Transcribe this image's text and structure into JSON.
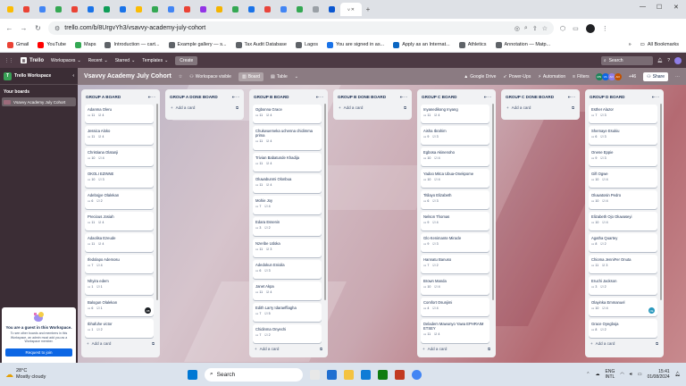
{
  "browser": {
    "active_tab_label": "V",
    "address": "trello.com/b/8UrgvYh3/vsavvy-academy-july-cohort",
    "bookmarks": [
      "Gmail",
      "YouTube",
      "Maps",
      "Introduction — cart...",
      "Example gallery — s...",
      "Tax Audit Database",
      "Lagos",
      "You are signed in as...",
      "Apply as an Internat...",
      "Athletics",
      "Annotation — Matp..."
    ],
    "all_bookmarks": "All Bookmarks"
  },
  "trello": {
    "logo": "Trello",
    "menu": [
      "Workspaces",
      "Recent",
      "Starred",
      "Templates"
    ],
    "create": "Create",
    "search": "Search"
  },
  "sidebar": {
    "workspace": "Trello Workspace",
    "your_boards": "Your boards",
    "board_item": "Vsavvy Academy July Cohort",
    "guest_title": "You are a guest in this Workspace.",
    "guest_body": "To see other boards and members in this Workspace, an admin must add you as a Workspace member.",
    "request": "Request to join"
  },
  "board": {
    "title": "Vsavvy Academy July Cohort",
    "visibility": "Workspace visible",
    "views": [
      "Board",
      "Table"
    ],
    "right": [
      "Google Drive",
      "Power-Ups",
      "Automation",
      "Filters"
    ],
    "more_members": "+46",
    "share": "Share",
    "member_avatars": [
      {
        "initials": "MN",
        "color": "#1f845a"
      },
      {
        "initials": "VA",
        "color": "#0c66e4"
      },
      {
        "initials": "AO",
        "color": "#8f7ee7"
      },
      {
        "initials": "AO",
        "color": "#c25100"
      }
    ]
  },
  "lists": [
    {
      "title": "GROUP A BOARD",
      "cards": [
        {
          "name": "Adanma Oleru",
          "comments": "11",
          "checks": "4"
        },
        {
          "name": "Jessica Aloko",
          "comments": "11",
          "checks": "4"
        },
        {
          "name": "Christiana Olatunji",
          "comments": "10",
          "checks": "4"
        },
        {
          "name": "OKOLI EZINNE",
          "comments": "10",
          "checks": "3"
        },
        {
          "name": "Adebojye Olalekan",
          "comments": "6",
          "checks": "2"
        },
        {
          "name": "Precious Josiah",
          "comments": "11",
          "checks": "4"
        },
        {
          "name": "Adaolisa Ezeude",
          "comments": "11",
          "checks": "4"
        },
        {
          "name": "Ifedolapo Ademosu",
          "comments": "7",
          "checks": "4"
        },
        {
          "name": "Nhyira edem",
          "comments": "1",
          "checks": "1"
        },
        {
          "name": "Balogun Olalekan",
          "comments": "6",
          "checks": "1",
          "avatar": "OB"
        },
        {
          "name": "Ibhafuhe victor",
          "comments": "1",
          "checks": "2"
        }
      ]
    },
    {
      "title": "GROUP A DONE BOARD",
      "cards": []
    },
    {
      "title": "GROUP B BOARD",
      "cards": [
        {
          "name": "Ogbonna Grace",
          "comments": "11",
          "checks": "4"
        },
        {
          "name": "Chukwuemeka uchenna chidimma prima",
          "comments": "11",
          "checks": "4"
        },
        {
          "name": "Trivian Babatunde Khadija",
          "comments": "11",
          "checks": "4"
        },
        {
          "name": "Oluwabunmi Olonbua",
          "comments": "11",
          "checks": "4"
        },
        {
          "name": "Mohie Joy",
          "comments": "7",
          "checks": "4"
        },
        {
          "name": "Edara Essenin",
          "comments": "3",
          "checks": "2"
        },
        {
          "name": "Nzeribe Udoka",
          "comments": "11",
          "checks": "3"
        },
        {
          "name": "Adedokun Enioila",
          "comments": "6",
          "checks": "3"
        },
        {
          "name": "Janet Akpa",
          "comments": "11",
          "checks": "4"
        },
        {
          "name": "Edith Larry Idaraeffiagha",
          "comments": "7",
          "checks": "5"
        },
        {
          "name": "Chidinma Onyechi",
          "comments": "7",
          "checks": "2"
        }
      ]
    },
    {
      "title": "GROUP B DONE BOARD",
      "cards": []
    },
    {
      "title": "GROUP C BOARD",
      "cards": [
        {
          "name": "Inyanedikong Inyang",
          "comments": "11",
          "checks": "4"
        },
        {
          "name": "Aisha Ibrahim",
          "comments": "9",
          "checks": "3"
        },
        {
          "name": "Egbosa Akinenoho",
          "comments": "10",
          "checks": "4"
        },
        {
          "name": "Yadoo Mitca Ubua-Onekpome",
          "comments": "10",
          "checks": "4"
        },
        {
          "name": "Titilayo Elizabeth",
          "comments": "6",
          "checks": "3"
        },
        {
          "name": "Nelson Thomas",
          "comments": "9",
          "checks": "4"
        },
        {
          "name": "Glo Kenimante Miracle",
          "comments": "9",
          "checks": "3"
        },
        {
          "name": "Hannatu Banuso",
          "comments": "7",
          "checks": "2"
        },
        {
          "name": "Brown Manda",
          "comments": "10",
          "checks": "4"
        },
        {
          "name": "Comfort Osunjimi",
          "comments": "4",
          "checks": "4"
        },
        {
          "name": "Deladem Mawunyo Yawa EPHRAIM ETSEY",
          "comments": "11",
          "checks": "4"
        }
      ]
    },
    {
      "title": "GROUP C DONE BOARD",
      "cards": []
    },
    {
      "title": "GROUP D BOARD",
      "cards": [
        {
          "name": "Esther Alazor",
          "comments": "7",
          "checks": "3"
        },
        {
          "name": "Shemaye Esukiu",
          "comments": "6",
          "checks": "3"
        },
        {
          "name": "Onene Eppie",
          "comments": "9",
          "checks": "3"
        },
        {
          "name": "Gift Ogwe",
          "comments": "10",
          "checks": "4"
        },
        {
          "name": "Oluwatosin Pedro",
          "comments": "10",
          "checks": "4"
        },
        {
          "name": "Elizabeth Ojo Oluwaseyi",
          "comments": "10",
          "checks": "4"
        },
        {
          "name": "Agatha Quartey",
          "comments": "8",
          "checks": "2"
        },
        {
          "name": "Chioma JenniFer Onuta",
          "comments": "11",
          "checks": "3"
        },
        {
          "name": "Eruchi Jackson",
          "comments": "3",
          "checks": "2"
        },
        {
          "name": "Olayinka Emmanuel",
          "comments": "10",
          "checks": "4",
          "avatar": "OE"
        },
        {
          "name": "Grace Oyegboja",
          "comments": "8",
          "checks": "2"
        }
      ]
    }
  ],
  "add_card": "Add a card",
  "taskbar": {
    "temp": "28°C",
    "weather": "Mostly cloudy",
    "search": "Search",
    "lang": "ENG",
    "region": "INTL",
    "time": "15:41",
    "date": "01/08/2024",
    "notif": "1"
  },
  "colors": {
    "trello_header": "#4d3a44",
    "sidebar": "#3b2d35",
    "accent": "#0c66e4"
  }
}
